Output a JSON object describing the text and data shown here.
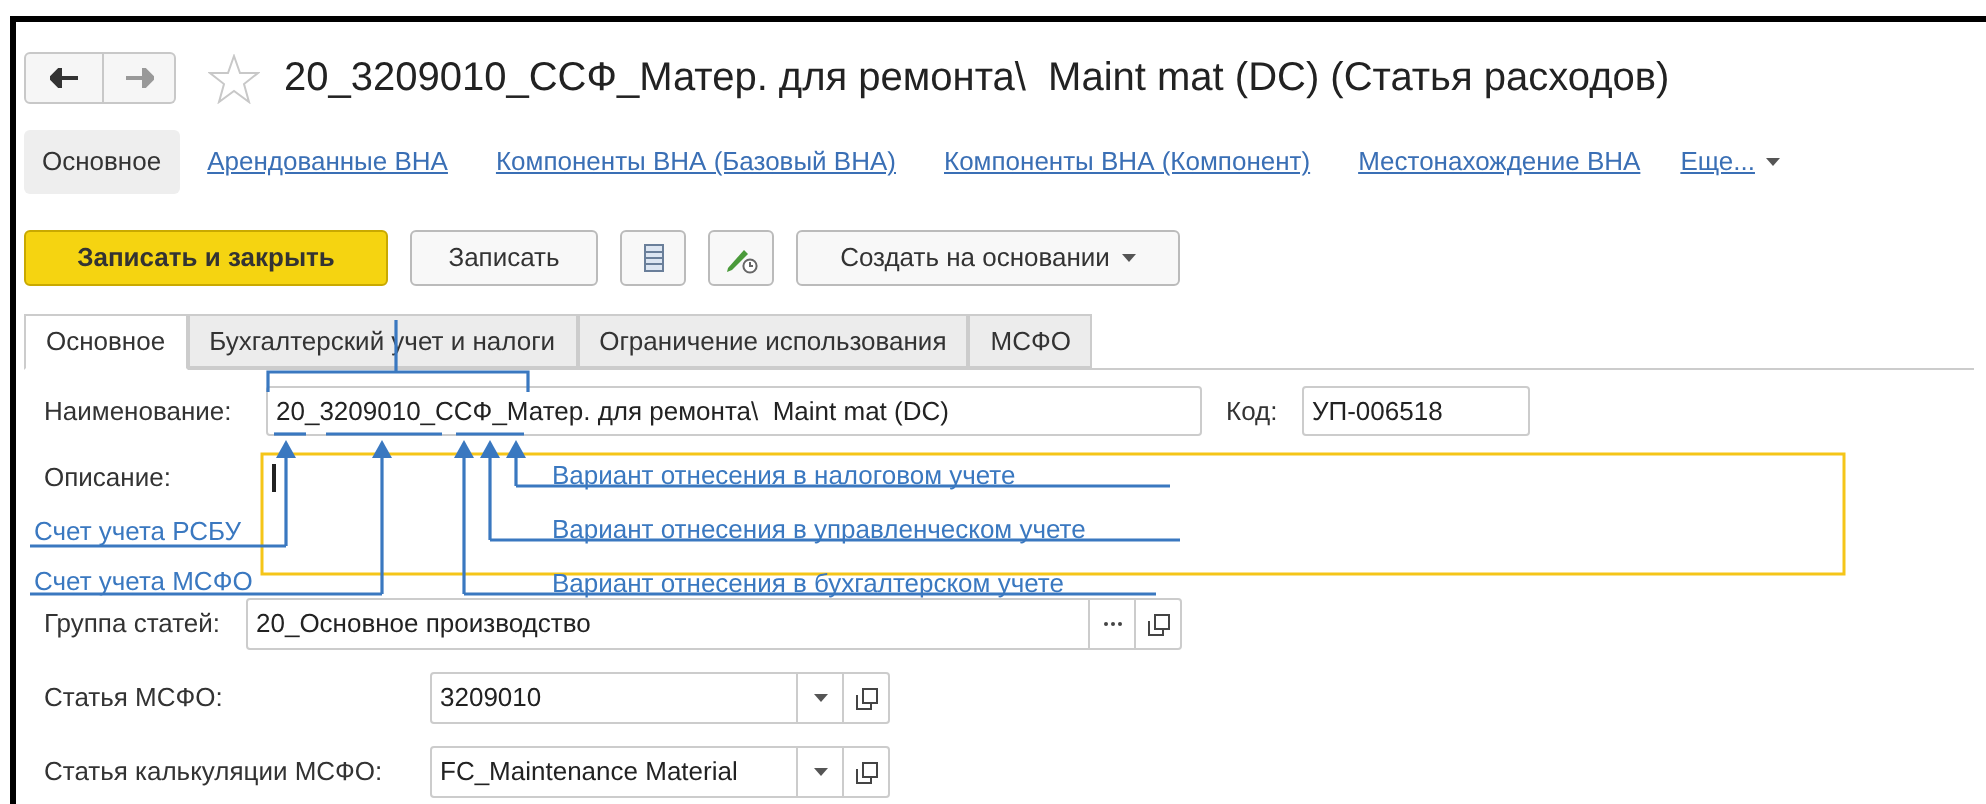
{
  "window": {
    "title": "20_3209010_ССФ_Матер. для ремонта\\  Maint mat (DC) (Статья расходов)"
  },
  "nav_panel": [
    {
      "label": "Основное",
      "selected": true,
      "kind": "link"
    },
    {
      "label": "Арендованные ВНА",
      "selected": false,
      "kind": "link"
    },
    {
      "label": "Компоненты ВНА (Базовый ВНА)",
      "selected": false,
      "kind": "link"
    },
    {
      "label": "Компоненты ВНА (Компонент)",
      "selected": false,
      "kind": "link"
    },
    {
      "label": "Местонахождение ВНА",
      "selected": false,
      "kind": "link"
    },
    {
      "label": "Еще...",
      "kind": "more"
    }
  ],
  "toolbar": [
    {
      "kind": "primary",
      "label": "Записать и закрыть"
    },
    {
      "kind": "default",
      "label": "Записать"
    },
    {
      "kind": "dropdown",
      "label": "Создать на основании"
    }
  ],
  "tabs": [
    {
      "label": "Основное",
      "selected": true
    },
    {
      "label": "Бухгалтерский учет и налоги",
      "selected": false
    },
    {
      "label": "Ограничение использования",
      "selected": false
    },
    {
      "label": "МСФО",
      "selected": false
    }
  ],
  "form": {
    "name": {
      "label": "Наименование:",
      "value": "20_3209010_ССФ_Матер. для ремонта\\  Maint mat (DC)"
    },
    "code": {
      "label": "Код:",
      "value": "УП-006518"
    },
    "description": {
      "label": "Описание:"
    },
    "group": {
      "label": "Группа статей:",
      "value": "20_Основное производство"
    },
    "ifrs_item": {
      "label": "Статья МСФО:",
      "value": "3209010"
    },
    "costing_item": {
      "label": "Статья калькуляции МСФО:",
      "value": "FC_Maintenance Material"
    }
  },
  "annotations": {
    "left": [
      "Счет учета РСБУ",
      "Счет учета МСФО"
    ],
    "right": [
      "Вариант отнесения в налоговом учете",
      "Вариант отнесения в управленческом учете",
      "Вариант отнесения в бухгалтерском учете"
    ]
  }
}
